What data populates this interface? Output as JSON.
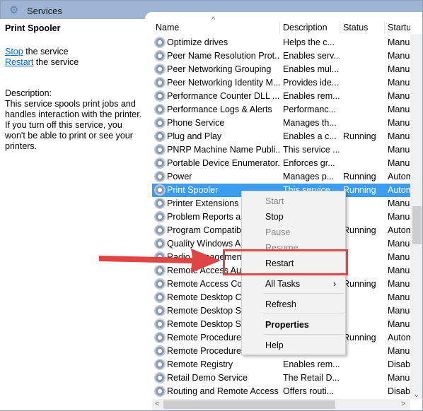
{
  "window": {
    "title": "Services",
    "icon": "gear-icon"
  },
  "left_pane": {
    "service_name": "Print Spooler",
    "stop_link": "Stop",
    "stop_suffix": " the service",
    "restart_link": "Restart",
    "restart_suffix": " the service",
    "description_label": "Description:",
    "description": "This service spools print jobs and handles interaction with the printer. If you turn off this service, you won't be able to print or see your printers."
  },
  "table": {
    "columns": [
      "Name",
      "Description",
      "Status",
      "Startup Type"
    ],
    "rows": [
      {
        "name": "Optimize drives",
        "desc": "Helps the c...",
        "status": "",
        "startup": "Manual"
      },
      {
        "name": "Peer Name Resolution Prot...",
        "desc": "Enables serv...",
        "status": "",
        "startup": "Manual"
      },
      {
        "name": "Peer Networking Grouping",
        "desc": "Enables mul...",
        "status": "",
        "startup": "Manual"
      },
      {
        "name": "Peer Networking Identity M...",
        "desc": "Provides ide...",
        "status": "",
        "startup": "Manual"
      },
      {
        "name": "Performance Counter DLL ...",
        "desc": "Enables rem...",
        "status": "",
        "startup": "Manual"
      },
      {
        "name": "Performance Logs & Alerts",
        "desc": "Performanc...",
        "status": "",
        "startup": "Manual"
      },
      {
        "name": "Phone Service",
        "desc": "Manages th...",
        "status": "",
        "startup": "Manual"
      },
      {
        "name": "Plug and Play",
        "desc": "Enables a c...",
        "status": "Running",
        "startup": "Manual"
      },
      {
        "name": "PNRP Machine Name Publi...",
        "desc": "This service ...",
        "status": "",
        "startup": "Manual"
      },
      {
        "name": "Portable Device Enumerator...",
        "desc": "Enforces gr...",
        "status": "",
        "startup": "Manual"
      },
      {
        "name": "Power",
        "desc": "Manages p...",
        "status": "Running",
        "startup": "Automatic"
      },
      {
        "name": "Print Spooler",
        "desc": "This service ...",
        "status": "Running",
        "startup": "Automatic"
      },
      {
        "name": "Printer Extensions an",
        "desc": "",
        "status": "",
        "startup": "Manual"
      },
      {
        "name": "Problem Reports an",
        "desc": "",
        "status": "",
        "startup": "Manual"
      },
      {
        "name": "Program Compatibi",
        "desc": "",
        "status": "Running",
        "startup": "Automatic"
      },
      {
        "name": "Quality Windows Au",
        "desc": "",
        "status": "",
        "startup": "Manual"
      },
      {
        "name": "Radio Management",
        "desc": "",
        "status": "",
        "startup": "Manual"
      },
      {
        "name": "Remote Access Auto",
        "desc": "",
        "status": "",
        "startup": "Manual"
      },
      {
        "name": "Remote Access Con",
        "desc": "",
        "status": "Running",
        "startup": "Manual"
      },
      {
        "name": "Remote Desktop Co",
        "desc": "",
        "status": "",
        "startup": "Manual"
      },
      {
        "name": "Remote Desktop Ser",
        "desc": "",
        "status": "",
        "startup": "Manual"
      },
      {
        "name": "Remote Desktop Ser",
        "desc": "",
        "status": "",
        "startup": "Manual"
      },
      {
        "name": "Remote Procedure C",
        "desc": "",
        "status": "Running",
        "startup": "Automatic"
      },
      {
        "name": "Remote Procedure C",
        "desc": "",
        "status": "",
        "startup": "Manual"
      },
      {
        "name": "Remote Registry",
        "desc": "Enables rem...",
        "status": "",
        "startup": "Disabled"
      },
      {
        "name": "Retail Demo Service",
        "desc": "The Retail D...",
        "status": "",
        "startup": "Manual"
      },
      {
        "name": "Routing and Remote Access",
        "desc": "Offers routi...",
        "status": "",
        "startup": "Disabled"
      }
    ],
    "selected_index": 11
  },
  "context_menu": {
    "items": [
      {
        "label": "Start",
        "enabled": false
      },
      {
        "label": "Stop",
        "enabled": true
      },
      {
        "label": "Pause",
        "enabled": false
      },
      {
        "label": "Resume",
        "enabled": false
      },
      {
        "label": "Restart",
        "enabled": true
      },
      {
        "label": "All Tasks",
        "enabled": true,
        "submenu": true
      },
      {
        "label": "Refresh",
        "enabled": true
      },
      {
        "label": "Properties",
        "enabled": true,
        "bold": true
      },
      {
        "label": "Help",
        "enabled": true
      }
    ]
  },
  "annotation": {
    "color": "#e04545"
  },
  "colors": {
    "selection": "#3c9cf0",
    "titlebar": "#9db4d2"
  }
}
